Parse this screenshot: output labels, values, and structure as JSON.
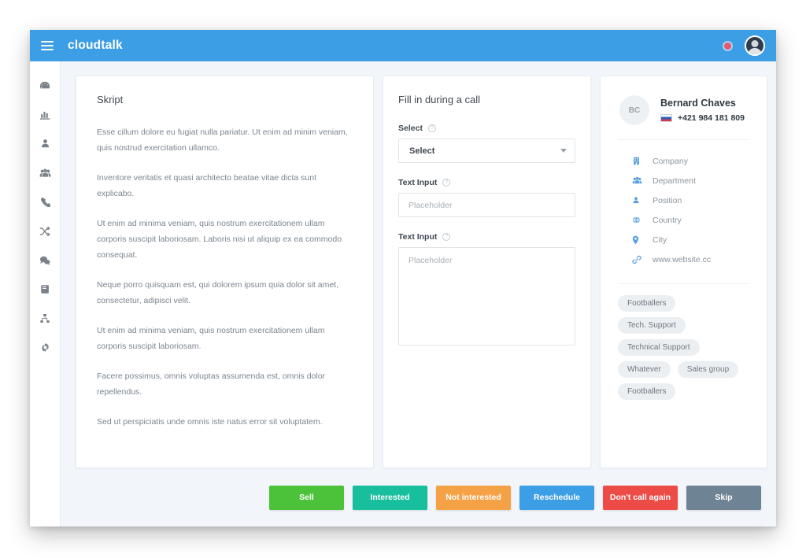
{
  "topbar": {
    "brand": "cloudtalk",
    "menu_icon": "hamburger-icon",
    "record_indicator": "recording-dot",
    "avatar_alt": "user-avatar",
    "background_color": "#3c9ee5"
  },
  "sidebar": {
    "items": [
      {
        "icon": "dashboard-icon",
        "name": "sidebar-item-dashboard"
      },
      {
        "icon": "statistics-icon",
        "name": "sidebar-item-statistics"
      },
      {
        "icon": "contact-icon",
        "name": "sidebar-item-contacts"
      },
      {
        "icon": "team-icon",
        "name": "sidebar-item-team"
      },
      {
        "icon": "phone-icon",
        "name": "sidebar-item-calls"
      },
      {
        "icon": "shuffle-icon",
        "name": "sidebar-item-routing"
      },
      {
        "icon": "chat-icon",
        "name": "sidebar-item-messages"
      },
      {
        "icon": "journal-icon",
        "name": "sidebar-item-journal"
      },
      {
        "icon": "sitemap-icon",
        "name": "sidebar-item-flows"
      },
      {
        "icon": "gear-icon",
        "name": "sidebar-item-settings"
      }
    ]
  },
  "script_panel": {
    "title": "Skript",
    "paragraphs": [
      "Esse cillum dolore eu fugiat nulla pariatur. Ut enim ad minim veniam, quis nostrud exercitation ullamco.",
      "Inventore veritatis et quasi architecto beatae vitae dicta sunt explicabo.",
      "Ut enim ad minima veniam, quis nostrum exercitationem ullam corporis suscipit laboriosam. Laboris nisi ut aliquip ex ea commodo consequat.",
      "Neque porro quisquam est, qui dolorem ipsum quia dolor sit amet, consectetur, adipisci velit.",
      "Ut enim ad minima veniam, quis nostrum exercitationem ullam corporis suscipit laboriosam.",
      "Facere possimus, omnis voluptas assumenda est, omnis dolor repellendus.",
      "Sed ut perspiciatis unde omnis iste natus error sit voluptatem."
    ]
  },
  "form_panel": {
    "title": "Fill in during a call",
    "info_glyph": "?",
    "select_field": {
      "label": "Select",
      "value": "Select",
      "caret": "chevron-down-icon"
    },
    "text_field": {
      "label": "Text Input",
      "value": "",
      "placeholder": "Placeholder"
    },
    "textarea_field": {
      "label": "Text Input",
      "value": "",
      "placeholder": "Placeholder"
    }
  },
  "contact_panel": {
    "initials": "BC",
    "name": "Bernard Chaves",
    "flag": "slovakia-flag",
    "phone": "+421 984 181 809",
    "details": [
      {
        "icon": "building-icon",
        "label": "Company"
      },
      {
        "icon": "users-icon",
        "label": "Department"
      },
      {
        "icon": "user-icon",
        "label": "Position"
      },
      {
        "icon": "globe-icon",
        "label": "Country"
      },
      {
        "icon": "pin-icon",
        "label": "City"
      },
      {
        "icon": "link-icon",
        "label": "www.website.cc"
      }
    ],
    "tags": [
      "Footballers",
      "Tech. Support",
      "Technical Support",
      "Whatever",
      "Sales group",
      "Footballers"
    ]
  },
  "actions": [
    {
      "label": "Sell",
      "color": "#4cc23a",
      "name": "sell-button"
    },
    {
      "label": "Interested",
      "color": "#17bf9e",
      "name": "interested-button"
    },
    {
      "label": "Not interested",
      "color": "#f5a247",
      "name": "not-interested-button"
    },
    {
      "label": "Reschedule",
      "color": "#3c9ee5",
      "name": "reschedule-button"
    },
    {
      "label": "Don't call again",
      "color": "#ed4b45",
      "name": "dont-call-again-button"
    },
    {
      "label": "Skip",
      "color": "#6e8394",
      "name": "skip-button"
    }
  ]
}
